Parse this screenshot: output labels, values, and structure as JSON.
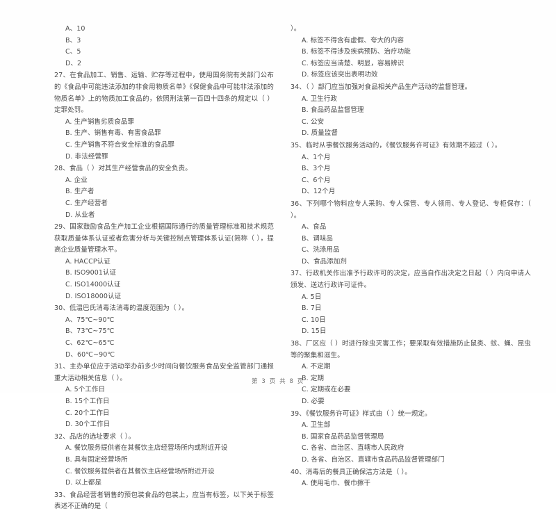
{
  "document": {
    "type": "exam-paper",
    "language": "zh-CN",
    "footer": {
      "prefix": "第",
      "page_number": "3",
      "middle": "页 共",
      "total_pages": "8",
      "suffix": "页",
      "full_text": "第 3 页 共 8 页"
    }
  },
  "left_column": {
    "carryover_options": [
      "A、10",
      "B、3",
      "C、5",
      "D、2"
    ],
    "questions": [
      {
        "number": "27",
        "stem": "27、在食品加工、销售、运输、贮存等过程中，使用国务院有关部门公布的《食品中可能违法添加的非食用物质名单》《保健食品中可能非法添加的物质名单》上的物质加工食品的，依照刑法第一百四十四条的规定以（    ）定罪处罚。",
        "options": [
          "A. 生产销售劣质食品罪",
          "B. 生产、销售有毒、有害食品罪",
          "C. 生产销售不符合安全标准的食品罪",
          "D. 非法经营罪"
        ]
      },
      {
        "number": "28",
        "stem": "28、食品（     ）对其生产经营食品的安全负责。",
        "options": [
          "A. 企业",
          "B. 生产者",
          "C. 生产经营者",
          "D. 从业者"
        ]
      },
      {
        "number": "29",
        "stem": "29、国家鼓励食品生产加工企业根据国际通行的质量管理标准和技术规范获取质量体系认证或者危害分析与关键控制点管理体系认证(简称（     ），提高企业质量管理水平。",
        "options": [
          "A. HACCP认证",
          "B. ISO9001认证",
          "C. ISO14000认证",
          "D. ISO18000认证"
        ]
      },
      {
        "number": "30",
        "stem": "30、低温巴氏消毒法消毒的温度范围为（     ）。",
        "options": [
          "A、75℃~90℃",
          "B、73℃~75℃",
          "C、62℃~65℃",
          "D、60℃~90℃"
        ]
      },
      {
        "number": "31",
        "stem": "31、主办单位应于活动举办前多少时间向餐饮服务食品安全监管部门通报重大活动相关信息（     ）。",
        "options": [
          "A. 5个工作日",
          "B. 15个工作日",
          "C. 20个工作日",
          "D. 30个工作日"
        ]
      },
      {
        "number": "32",
        "stem": "32、品店的选址要求（     ）。",
        "options": [
          "A. 餐饮服务提供者在其餐饮主店经营场所内或附近开设",
          "B. 具有固定经营场所",
          "C. 餐饮服务提供者在其餐饮主店经营场所附近开设",
          "D. 以上都是"
        ]
      },
      {
        "number": "33",
        "stem": "33、食品经营者销售的预包装食品的包装上，应当有标签，以下关于标签表述不正确的是（",
        "options": []
      }
    ]
  },
  "right_column": {
    "carryover_stem_tail": "）。",
    "carryover_options": [
      "A. 标签不得含有虚假、夸大的内容",
      "B. 标签不得涉及疾病预防、治疗功能",
      "C. 标签应当清楚、明显，容易辨识",
      "D. 标签应该突出表明功效"
    ],
    "questions": [
      {
        "number": "34",
        "stem": "34、（     ）部门应当加强对食品相关产品生产活动的监督管理。",
        "options": [
          "A. 卫生行政",
          "B. 食品药品监督管理",
          "C. 公安",
          "D. 质量监督"
        ]
      },
      {
        "number": "35",
        "stem": "35、临时从事餐饮服务活动的，《餐饮服务许可证》有效期不超过（     ）。",
        "options": [
          "A、1个月",
          "B、3个月",
          "C、6个月",
          "D、12个月"
        ]
      },
      {
        "number": "36",
        "stem": "36、下列哪个物料应专人采购、专人保管、专人领用、专人登记、专柜保存：（     ）。",
        "options": [
          "A、食品",
          "B、调味品",
          "C、洗涤用品",
          "D、食品添加剂"
        ]
      },
      {
        "number": "37",
        "stem": "37、行政机关作出准予行政许可的决定，应当自作出决定之日起（     ）内向申请人颁发、送达行政许可证件。",
        "options": [
          "A. 5日",
          "B. 7日",
          "C. 10日",
          "D. 15日"
        ]
      },
      {
        "number": "38",
        "stem": "38、厂区应（     ）时进行除虫灭害工作；要采取有效措施防止鼠类、蚊、蝇、昆虫等的聚集和滋生。",
        "options": [
          "A. 不定期",
          "B. 定期",
          "C. 定期或在必要",
          "D. 必要"
        ]
      },
      {
        "number": "39",
        "stem": "39、《餐饮服务许可证》样式由（     ）统一规定。",
        "options": [
          "A. 卫生部",
          "B. 国家食品药品监督管理局",
          "C. 各省、自治区、直辖市人民政府",
          "D. 各省、自治区、直辖市食品药品监督管理部门"
        ]
      },
      {
        "number": "40",
        "stem": "40、消毒后的餐具正确保洁方法是（     ）。",
        "options": [
          "A. 使用毛巾、餐巾擦干"
        ]
      }
    ]
  }
}
